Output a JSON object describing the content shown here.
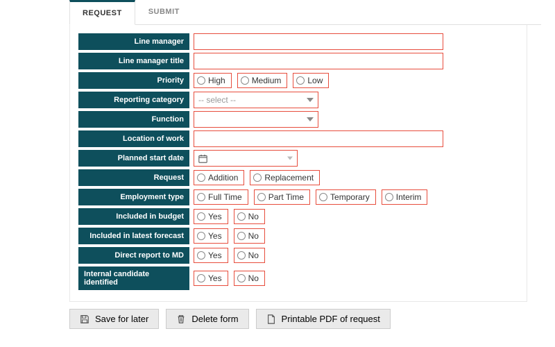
{
  "tabs": {
    "request": "REQUEST",
    "submit": "SUBMIT"
  },
  "labels": {
    "line_manager": "Line manager",
    "line_manager_title": "Line manager title",
    "priority": "Priority",
    "reporting_category": "Reporting category",
    "function": "Function",
    "location_of_work": "Location of work",
    "planned_start_date": "Planned start date",
    "request": "Request",
    "employment_type": "Employment type",
    "included_in_budget": "Included in budget",
    "included_in_latest_forecast": "Included in latest forecast",
    "direct_report_to_md": "Direct report to MD",
    "internal_candidate_identified": "Internal candidate identified"
  },
  "options": {
    "priority": [
      "High",
      "Medium",
      "Low"
    ],
    "request": [
      "Addition",
      "Replacement"
    ],
    "employment_type": [
      "Full Time",
      "Part Time",
      "Temporary",
      "Interim"
    ],
    "yes_no": [
      "Yes",
      "No"
    ]
  },
  "select_placeholder": "-- select --",
  "actions": {
    "save": "Save for later",
    "delete": "Delete form",
    "pdf": "Printable PDF of request"
  }
}
